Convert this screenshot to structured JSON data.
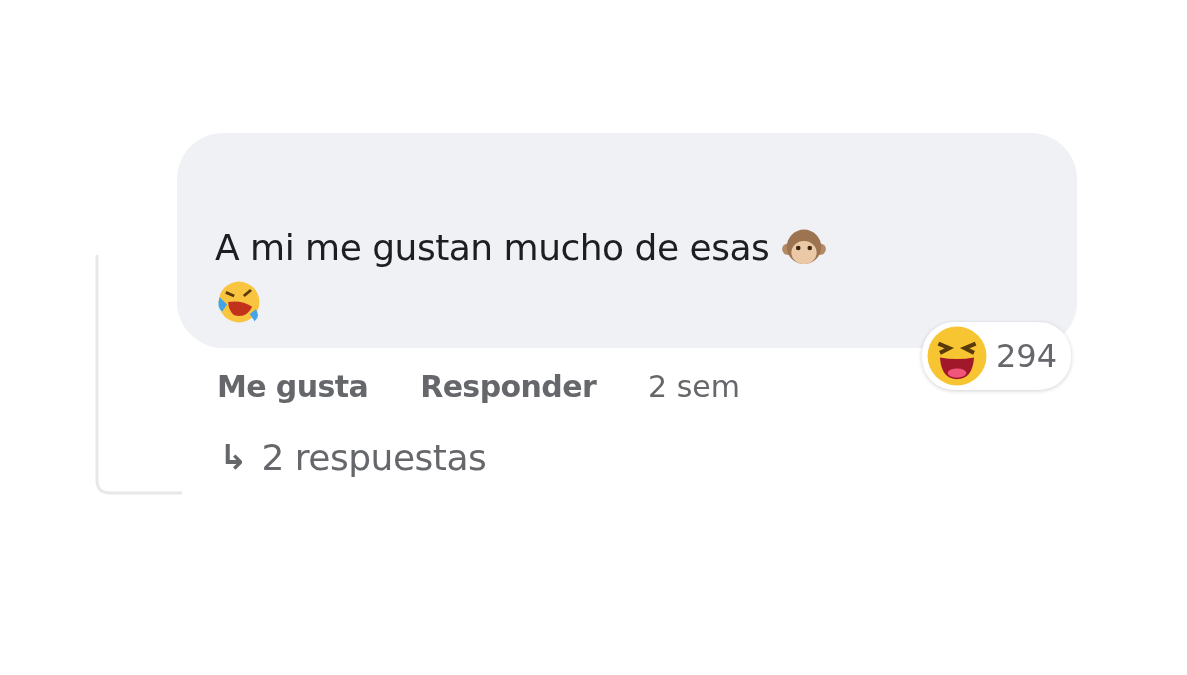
{
  "comment": {
    "text": "A mi me gustan mucho de esas",
    "reaction_count": "294"
  },
  "actions": [
    {
      "kind": "link",
      "label": "Me gusta"
    },
    {
      "kind": "link",
      "label": "Responder"
    },
    {
      "kind": "time",
      "label": "2 sem"
    }
  ],
  "replies": {
    "icon": "↳",
    "label": "2 respuestas"
  }
}
